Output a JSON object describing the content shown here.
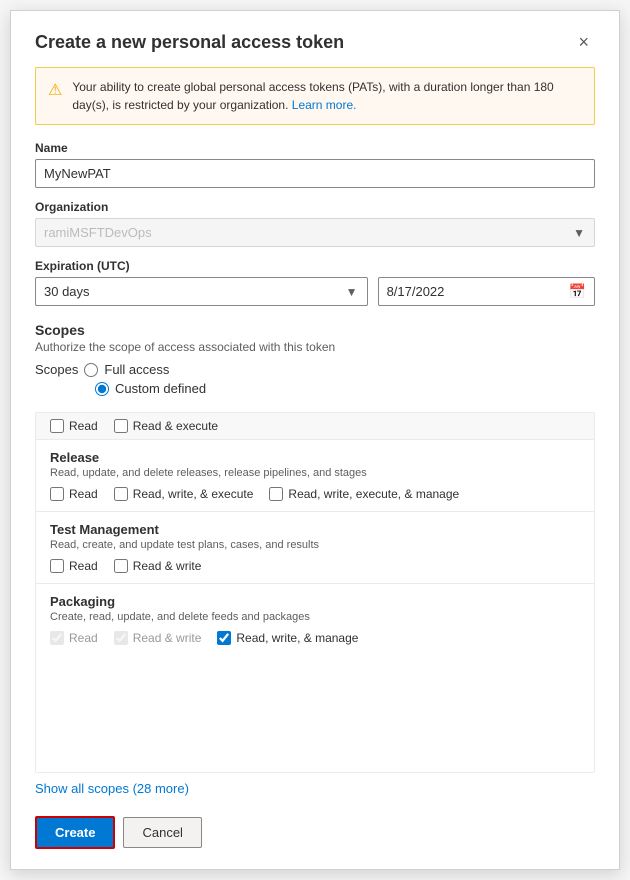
{
  "dialog": {
    "title": "Create a new personal access token",
    "close_label": "×"
  },
  "warning": {
    "icon": "⚠",
    "text": "Your ability to create global personal access tokens (PATs), with a duration longer than 180 day(s), is restricted by your organization.",
    "link_text": "Learn more.",
    "link_href": "#"
  },
  "name_field": {
    "label": "Name",
    "value": "MyNewPAT",
    "placeholder": ""
  },
  "organization_field": {
    "label": "Organization",
    "value": "ramiMSFTDevOps"
  },
  "expiration_field": {
    "label": "Expiration (UTC)",
    "days_option": "30 days",
    "date_value": "8/17/2022"
  },
  "scopes_section": {
    "title": "Scopes",
    "description": "Authorize the scope of access associated with this token",
    "scopes_label": "Scopes",
    "full_access_label": "Full access",
    "custom_defined_label": "Custom defined"
  },
  "partial_row": {
    "checkbox1_label": "Read",
    "checkbox2_label": "Read & execute"
  },
  "scope_groups": [
    {
      "title": "Release",
      "description": "Read, update, and delete releases, release pipelines, and stages",
      "options": [
        {
          "label": "Read",
          "checked": false,
          "disabled": false
        },
        {
          "label": "Read, write, & execute",
          "checked": false,
          "disabled": false
        },
        {
          "label": "Read, write, execute, & manage",
          "checked": false,
          "disabled": false
        }
      ]
    },
    {
      "title": "Test Management",
      "description": "Read, create, and update test plans, cases, and results",
      "options": [
        {
          "label": "Read",
          "checked": false,
          "disabled": false
        },
        {
          "label": "Read & write",
          "checked": false,
          "disabled": false
        }
      ]
    },
    {
      "title": "Packaging",
      "description": "Create, read, update, and delete feeds and packages",
      "options": [
        {
          "label": "Read",
          "checked": true,
          "disabled": true
        },
        {
          "label": "Read & write",
          "checked": true,
          "disabled": true
        },
        {
          "label": "Read, write, & manage",
          "checked": true,
          "disabled": false
        }
      ]
    }
  ],
  "show_all": {
    "text": "Show all scopes",
    "count": "(28 more)"
  },
  "buttons": {
    "create_label": "Create",
    "cancel_label": "Cancel"
  }
}
